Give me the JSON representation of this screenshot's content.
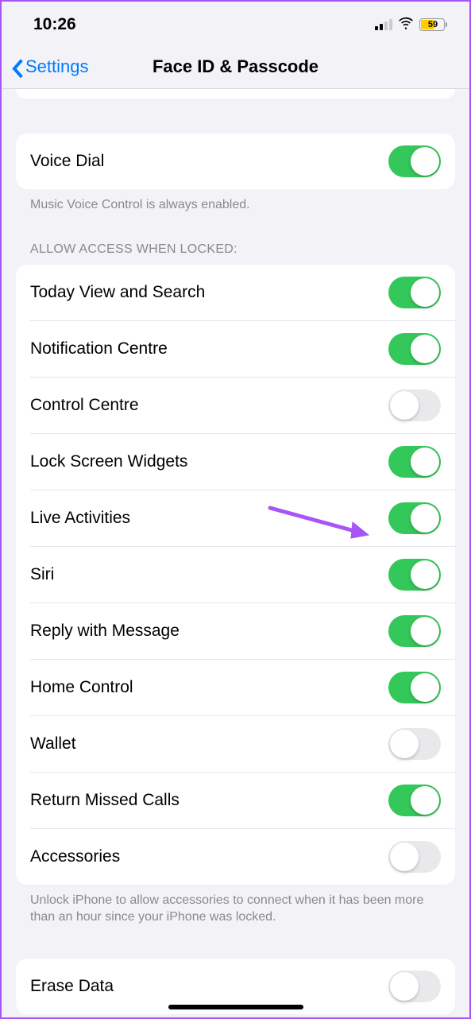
{
  "status": {
    "time": "10:26",
    "battery": "59"
  },
  "nav": {
    "back_label": "Settings",
    "title": "Face ID & Passcode"
  },
  "voice_dial": {
    "label": "Voice Dial",
    "on": true,
    "footer": "Music Voice Control is always enabled."
  },
  "allow_access": {
    "header": "ALLOW ACCESS WHEN LOCKED:",
    "rows": [
      {
        "label": "Today View and Search",
        "on": true
      },
      {
        "label": "Notification Centre",
        "on": true
      },
      {
        "label": "Control Centre",
        "on": false
      },
      {
        "label": "Lock Screen Widgets",
        "on": true
      },
      {
        "label": "Live Activities",
        "on": true
      },
      {
        "label": "Siri",
        "on": true
      },
      {
        "label": "Reply with Message",
        "on": true
      },
      {
        "label": "Home Control",
        "on": true
      },
      {
        "label": "Wallet",
        "on": false
      },
      {
        "label": "Return Missed Calls",
        "on": true
      },
      {
        "label": "Accessories",
        "on": false
      }
    ],
    "footer": "Unlock iPhone to allow accessories to connect when it has been more than an hour since your iPhone was locked."
  },
  "erase_data": {
    "label": "Erase Data",
    "on": false
  }
}
